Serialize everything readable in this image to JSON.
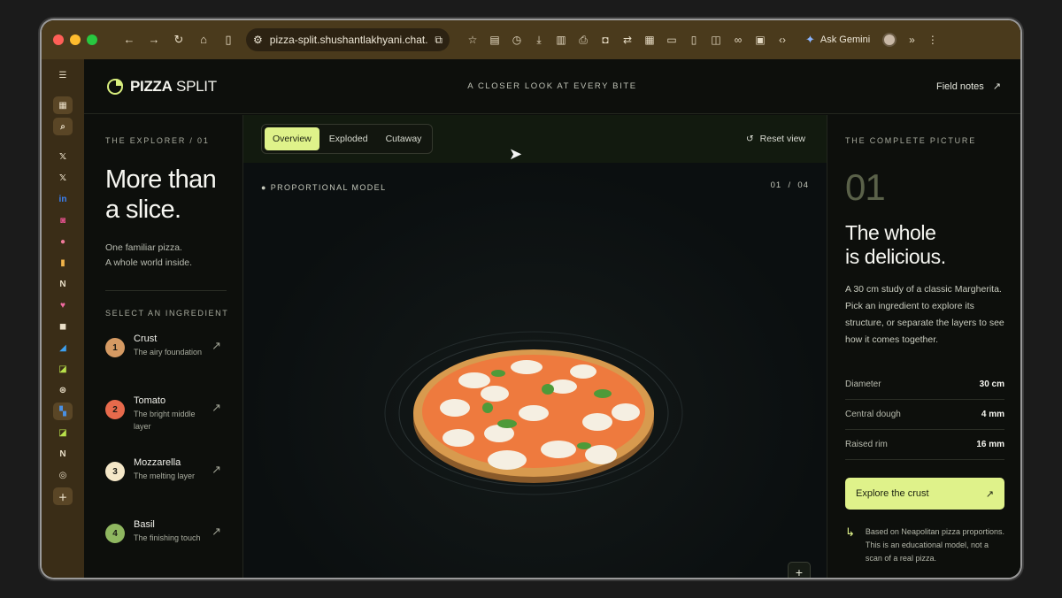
{
  "browser": {
    "url": "pizza-split.shushantlakhyani.chat...",
    "ask_gemini": "Ask Gemini"
  },
  "header": {
    "logo_bold": "PIZZA",
    "logo_light": " SPLIT",
    "tagline": "A CLOSER LOOK AT EVERY BITE",
    "field_notes": "Field notes"
  },
  "explorer": {
    "eyebrow": "THE EXPLORER / 01",
    "title_line1": "More than",
    "title_line2": "a slice.",
    "sub_line1": "One familiar pizza.",
    "sub_line2": "A whole world inside.",
    "select_label": "SELECT AN INGREDIENT",
    "ingredients": [
      {
        "num": "1",
        "name": "Crust",
        "desc": "The airy foundation",
        "color": "#d59a63"
      },
      {
        "num": "2",
        "name": "Tomato",
        "desc": "The bright middle layer",
        "color": "#e76a4c"
      },
      {
        "num": "3",
        "name": "Mozzarella",
        "desc": "The melting layer",
        "color": "#f4e7c8"
      },
      {
        "num": "4",
        "name": "Basil",
        "desc": "The finishing touch",
        "color": "#8fb760"
      }
    ]
  },
  "viewer": {
    "tabs": [
      "Overview",
      "Exploded",
      "Cutaway"
    ],
    "active_tab": "Overview",
    "reset": "Reset view",
    "model_label": "PROPORTIONAL MODEL",
    "counter_current": "01",
    "counter_sep": "/",
    "counter_total": "04",
    "zoom_plus": "+"
  },
  "picture": {
    "eyebrow": "THE COMPLETE PICTURE",
    "number": "01",
    "title_line1": "The whole",
    "title_line2": "is delicious.",
    "description": "A 30 cm study of a classic Margherita. Pick an ingredient to explore its structure, or separate the layers to see how it comes together.",
    "specs": [
      {
        "label": "Diameter",
        "value": "30 cm"
      },
      {
        "label": "Central dough",
        "value": "4 mm"
      },
      {
        "label": "Raised rim",
        "value": "16 mm"
      }
    ],
    "cta": "Explore the crust",
    "note": "Based on Neapolitan pizza proportions. This is an educational model, not a scan of a real pizza."
  },
  "colors": {
    "accent": "#dff28a",
    "background": "#0d0f0c",
    "browser_chrome": "#4a3a1c"
  }
}
